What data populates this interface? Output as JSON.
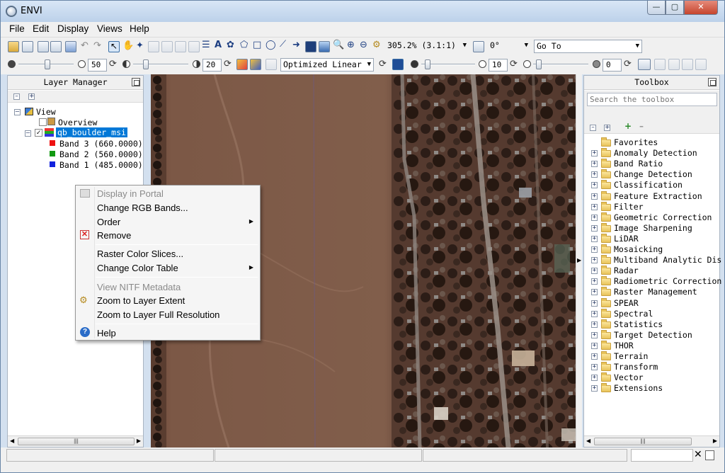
{
  "window": {
    "title": "ENVI"
  },
  "menubar": [
    "File",
    "Edit",
    "Display",
    "Views",
    "Help"
  ],
  "toolbar1": {
    "zoom_value": "305.2% (3.1:1)",
    "rotation_value": "0°",
    "goto_value": "Go To"
  },
  "toolbar2": {
    "brightness_value": "50",
    "contrast_value": "20",
    "stretch_value": "Optimized Linear",
    "sharpen_value": "10",
    "transparency_value": "0"
  },
  "layer_manager": {
    "title": "Layer Manager",
    "view_label": "View",
    "overview_label": "Overview",
    "raster_label": "qb_boulder_msi",
    "bands": [
      {
        "label": "Band 3 (660.0000)",
        "color": "#ee1111"
      },
      {
        "label": "Band 2 (560.0000)",
        "color": "#119911"
      },
      {
        "label": "Band 1 (485.0000)",
        "color": "#1122dd"
      }
    ]
  },
  "context_menu": {
    "display_in_portal": "Display in Portal",
    "change_rgb_bands": "Change RGB Bands...",
    "order": "Order",
    "remove": "Remove",
    "raster_color_slices": "Raster Color Slices...",
    "change_color_table": "Change Color Table",
    "view_nitf_metadata": "View NITF Metadata",
    "zoom_to_layer_extent": "Zoom to Layer Extent",
    "zoom_to_layer_full_resolution": "Zoom to Layer Full Resolution",
    "help": "Help"
  },
  "toolbox": {
    "title": "Toolbox",
    "search_placeholder": "Search the toolbox",
    "folders": [
      "Favorites",
      "Anomaly Detection",
      "Band Ratio",
      "Change Detection",
      "Classification",
      "Feature Extraction",
      "Filter",
      "Geometric Correction",
      "Image Sharpening",
      "LiDAR",
      "Mosaicking",
      "Multiband Analytic Dis",
      "Radar",
      "Radiometric Correction",
      "Raster Management",
      "SPEAR",
      "Spectral",
      "Statistics",
      "Target Detection",
      "THOR",
      "Terrain",
      "Transform",
      "Vector",
      "Extensions"
    ]
  },
  "colors": {
    "selection": "#0078d7",
    "titlebar": "#c5d7ee",
    "close_button": "#c6452e"
  }
}
